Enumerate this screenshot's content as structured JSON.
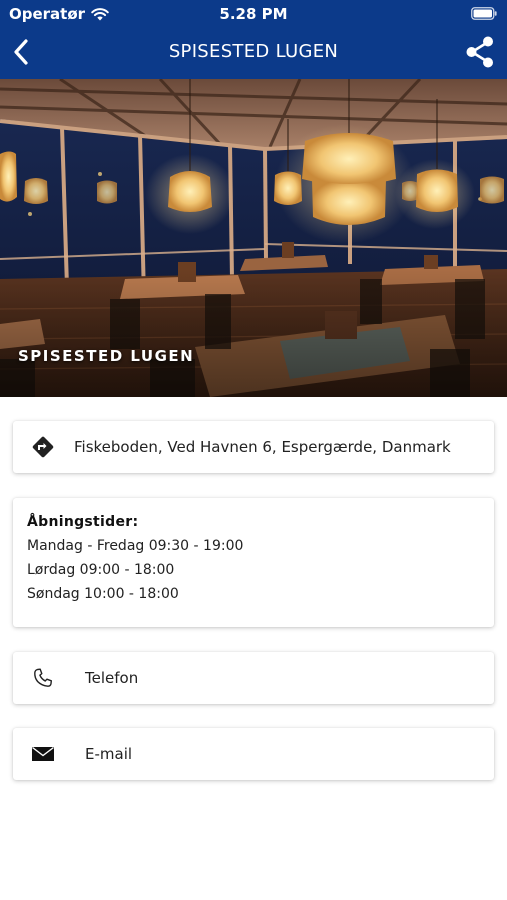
{
  "status_bar": {
    "carrier": "Operatør",
    "time": "5.28 PM"
  },
  "nav": {
    "title": "SPISESTED LUGEN",
    "back_icon": "chevron-left-icon",
    "share_icon": "share-icon"
  },
  "hero": {
    "caption": "SPISESTED LUGEN"
  },
  "address": {
    "icon": "directions-icon",
    "text": "Fiskeboden, Ved Havnen 6, Espergærde, Danmark"
  },
  "hours": {
    "title": "Åbningstider:",
    "lines": [
      "Mandag - Fredag 09:30 - 19:00",
      "Lørdag 09:00 - 18:00",
      "Søndag 10:00 - 18:00"
    ]
  },
  "contact": {
    "phone_label": "Telefon",
    "phone_icon": "phone-icon",
    "email_label": "E-mail",
    "email_icon": "mail-icon"
  },
  "colors": {
    "header": "#0c3a8a",
    "text": "#222222"
  }
}
